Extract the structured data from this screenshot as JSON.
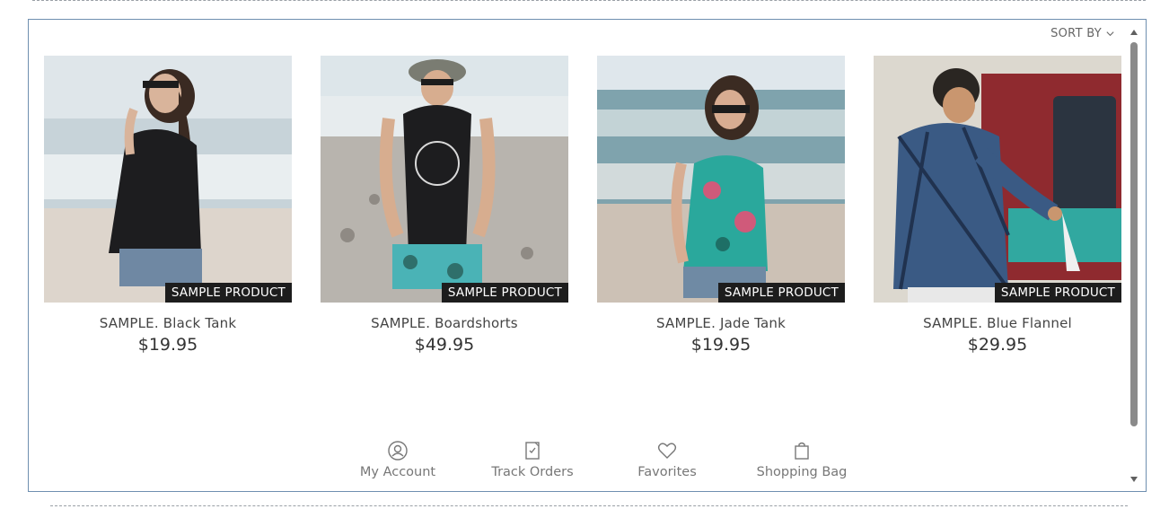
{
  "sort": {
    "label": "SORT BY"
  },
  "badge_text": "SAMPLE PRODUCT",
  "products": [
    {
      "name": "SAMPLE. Black Tank",
      "price": "$19.95"
    },
    {
      "name": "SAMPLE. Boardshorts",
      "price": "$49.95"
    },
    {
      "name": "SAMPLE. Jade Tank",
      "price": "$19.95"
    },
    {
      "name": "SAMPLE. Blue Flannel",
      "price": "$29.95"
    }
  ],
  "bottom_nav": [
    {
      "label": "My Account",
      "icon": "account-icon"
    },
    {
      "label": "Track Orders",
      "icon": "track-orders-icon"
    },
    {
      "label": "Favorites",
      "icon": "heart-icon"
    },
    {
      "label": "Shopping Bag",
      "icon": "shopping-bag-icon"
    }
  ]
}
